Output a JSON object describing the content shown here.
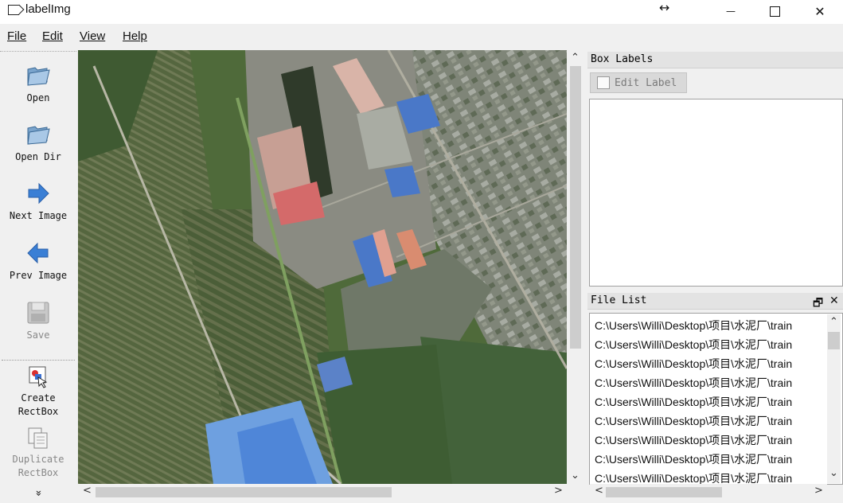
{
  "window": {
    "title": "labelImg",
    "resize_glyph": "↔",
    "minimize_glyph": "—",
    "close_glyph": "✕"
  },
  "menu": [
    "File",
    "Edit",
    "View",
    "Help"
  ],
  "toolbar": {
    "open": "Open",
    "open_dir": "Open Dir",
    "next_image": "Next Image",
    "prev_image": "Prev Image",
    "save": "Save",
    "create_rectbox_1": "Create",
    "create_rectbox_2": "RectBox",
    "duplicate_rectbox_1": "Duplicate",
    "duplicate_rectbox_2": "RectBox",
    "more": "»"
  },
  "box_labels": {
    "title": "Box Labels",
    "edit_label": "Edit Label"
  },
  "file_list": {
    "title": "File List",
    "float_glyph": "🗗",
    "close_glyph": "✕",
    "items": [
      "C:\\Users\\Willi\\Desktop\\项目\\水泥厂\\train",
      "C:\\Users\\Willi\\Desktop\\项目\\水泥厂\\train",
      "C:\\Users\\Willi\\Desktop\\项目\\水泥厂\\train",
      "C:\\Users\\Willi\\Desktop\\项目\\水泥厂\\train",
      "C:\\Users\\Willi\\Desktop\\项目\\水泥厂\\train",
      "C:\\Users\\Willi\\Desktop\\项目\\水泥厂\\train",
      "C:\\Users\\Willi\\Desktop\\项目\\水泥厂\\train",
      "C:\\Users\\Willi\\Desktop\\项目\\水泥厂\\train",
      "C:\\Users\\Willi\\Desktop\\项目\\水泥厂\\train"
    ]
  },
  "icons": {
    "folder": "folder-icon",
    "next": "arrow-right-icon",
    "prev": "arrow-left-icon",
    "save": "save-icon",
    "create": "create-rect-icon",
    "duplicate": "duplicate-icon"
  },
  "colors": {
    "arrow_blue": "#3a7fd5",
    "folder_blue": "#8fb4d8",
    "roof_blue": "#4a78c8",
    "field_green": "#4f6b3a"
  }
}
